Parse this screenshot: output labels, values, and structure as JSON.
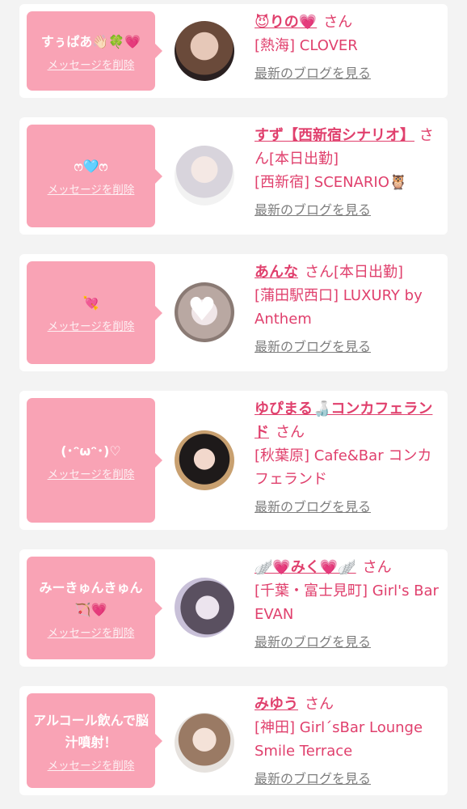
{
  "delete_label": "メッセージを削除",
  "san_label": "さん",
  "blog_label": "最新のブログを見る",
  "colors": {
    "accent": "#e0406d",
    "bubble": "#f9a3b5",
    "background": "#f3f3f3",
    "muted": "#7e7e7e"
  },
  "entries": [
    {
      "message": "すぅぱあ👋🏻🍀💗",
      "name": "😈りの💗",
      "suffix": "",
      "store": "[熱海] CLOVER"
    },
    {
      "message": "ෆ🩵ෆ",
      "name": "すず【西新宿シナリオ】",
      "suffix": "[本日出勤]",
      "store": "[西新宿] SCENARIO🦉"
    },
    {
      "message": "💘",
      "name": "あんな",
      "suffix": "[本日出勤]",
      "store": "[蒲田駅西口] LUXURY by Anthem"
    },
    {
      "message": "(･ᵔωᵔ･)♡",
      "name": "ゆぴまる🍶コンカフェランド",
      "suffix": "",
      "store": "[秋葉原] Cafe&Bar コンカフェランド"
    },
    {
      "message": "みーきゅんきゅん🏹💗",
      "name": "🪽💗みく💗🪽",
      "suffix": "",
      "store": "[千葉・富士見町] Girl's Bar EVAN"
    },
    {
      "message": "アルコール飲んで脳汁噴射！",
      "name": "みゆう",
      "suffix": "",
      "store": "[神田] Girl´sBar Lounge Smile Terrace"
    }
  ]
}
